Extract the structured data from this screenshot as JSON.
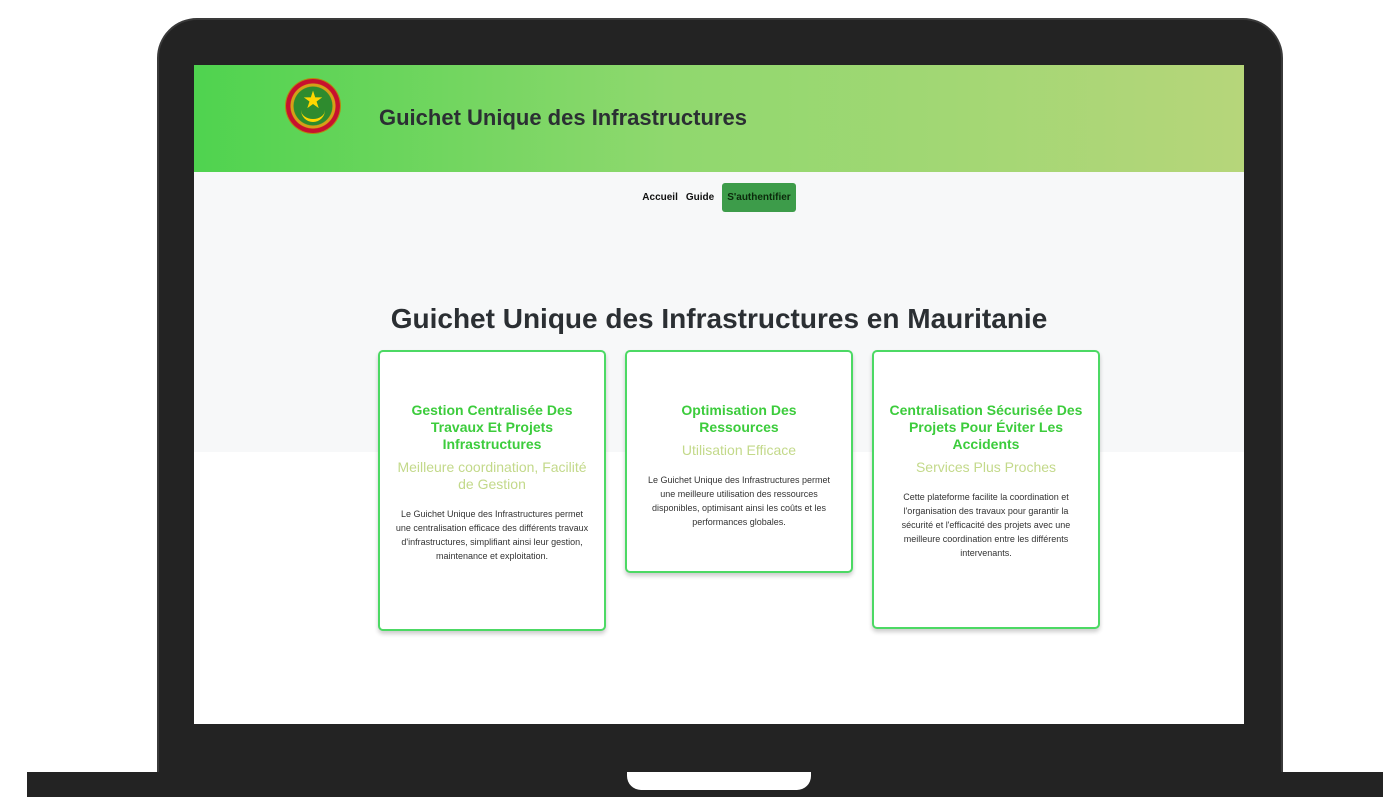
{
  "header": {
    "title": "Guichet Unique des Infrastructures",
    "logo": "mauritania-emblem-icon",
    "gradient_start": "#4fd34f",
    "gradient_end": "#b6d67a"
  },
  "nav": {
    "items": [
      {
        "label": "Accueil"
      },
      {
        "label": "Guide"
      }
    ],
    "login_label": "S'authentifier",
    "login_color": "#3d9c4a"
  },
  "hero": {
    "title": "Guichet Unique des Infrastructures en Mauritanie"
  },
  "cards": [
    {
      "title": "Gestion Centralisée Des Travaux Et Projets Infrastructures",
      "subtitle": "Meilleure coordination, Facilité de Gestion",
      "description": "Le Guichet Unique des Infrastructures permet une centralisation efficace des différents travaux d'infrastructures, simplifiant ainsi leur gestion, maintenance et exploitation."
    },
    {
      "title": "Optimisation Des Ressources",
      "subtitle": "Utilisation Efficace",
      "description": "Le Guichet Unique des Infrastructures permet une meilleure utilisation des ressources disponibles, optimisant ainsi les coûts et les performances globales."
    },
    {
      "title": "Centralisation Sécurisée Des Projets Pour Éviter Les Accidents",
      "subtitle": "Services Plus Proches",
      "description": "Cette plateforme facilite la coordination et l'organisation des travaux pour garantir la sécurité et l'efficacité des projets avec une meilleure coordination entre les différents intervenants."
    }
  ],
  "colors": {
    "accent_green": "#3ccc3c",
    "card_border": "#4cd964",
    "subtitle": "#c3d98a"
  }
}
